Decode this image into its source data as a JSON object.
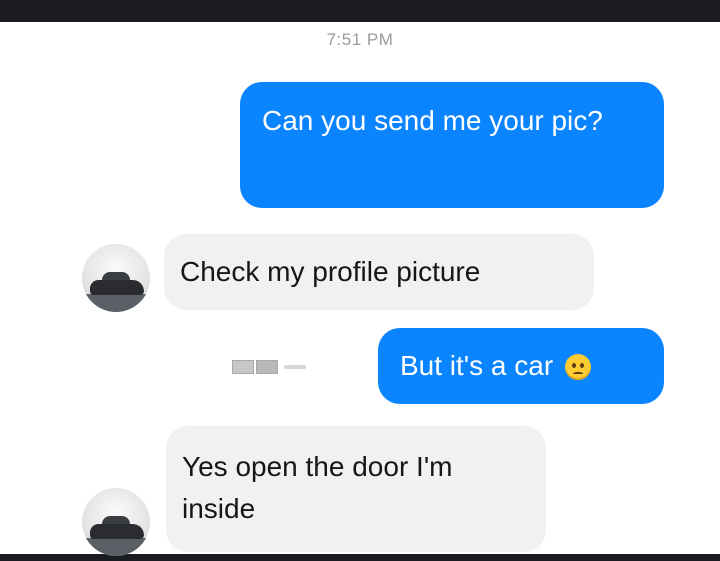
{
  "conversation": {
    "timestamp": "7:51 PM",
    "messages": [
      {
        "sender": "me",
        "text": "Can you send me your pic?"
      },
      {
        "sender": "them",
        "text": "Check my profile picture"
      },
      {
        "sender": "me",
        "text": "But it's a car",
        "emoji": "worried-face-emoji"
      },
      {
        "sender": "them",
        "text": "Yes open the door I'm inside"
      }
    ]
  },
  "theme": {
    "outgoing_bubble_color": "#0a84ff",
    "incoming_bubble_color": "#f1f1f3"
  }
}
